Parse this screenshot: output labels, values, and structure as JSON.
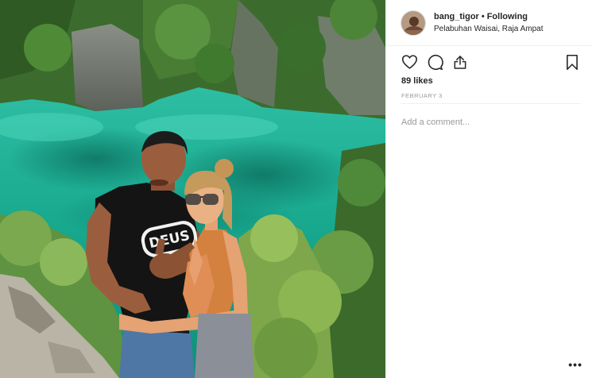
{
  "post": {
    "username": "bang_tigor",
    "separator": "•",
    "follow_status": "Following",
    "location": "Pelabuhan Waisai, Raja Ampat",
    "likes": "89 likes",
    "date": "FEBRUARY 3",
    "comment_placeholder": "Add a comment...",
    "more_label": "•••"
  },
  "photo": {
    "shirt_text": "DEUS"
  },
  "icons": {
    "like": "heart-icon",
    "comment": "comment-icon",
    "share": "share-icon",
    "save": "bookmark-icon",
    "more": "more-options-icon"
  },
  "colors": {
    "text": "#262626",
    "muted": "#999999",
    "border": "#efefef",
    "lagoon": "#1fb19a"
  }
}
